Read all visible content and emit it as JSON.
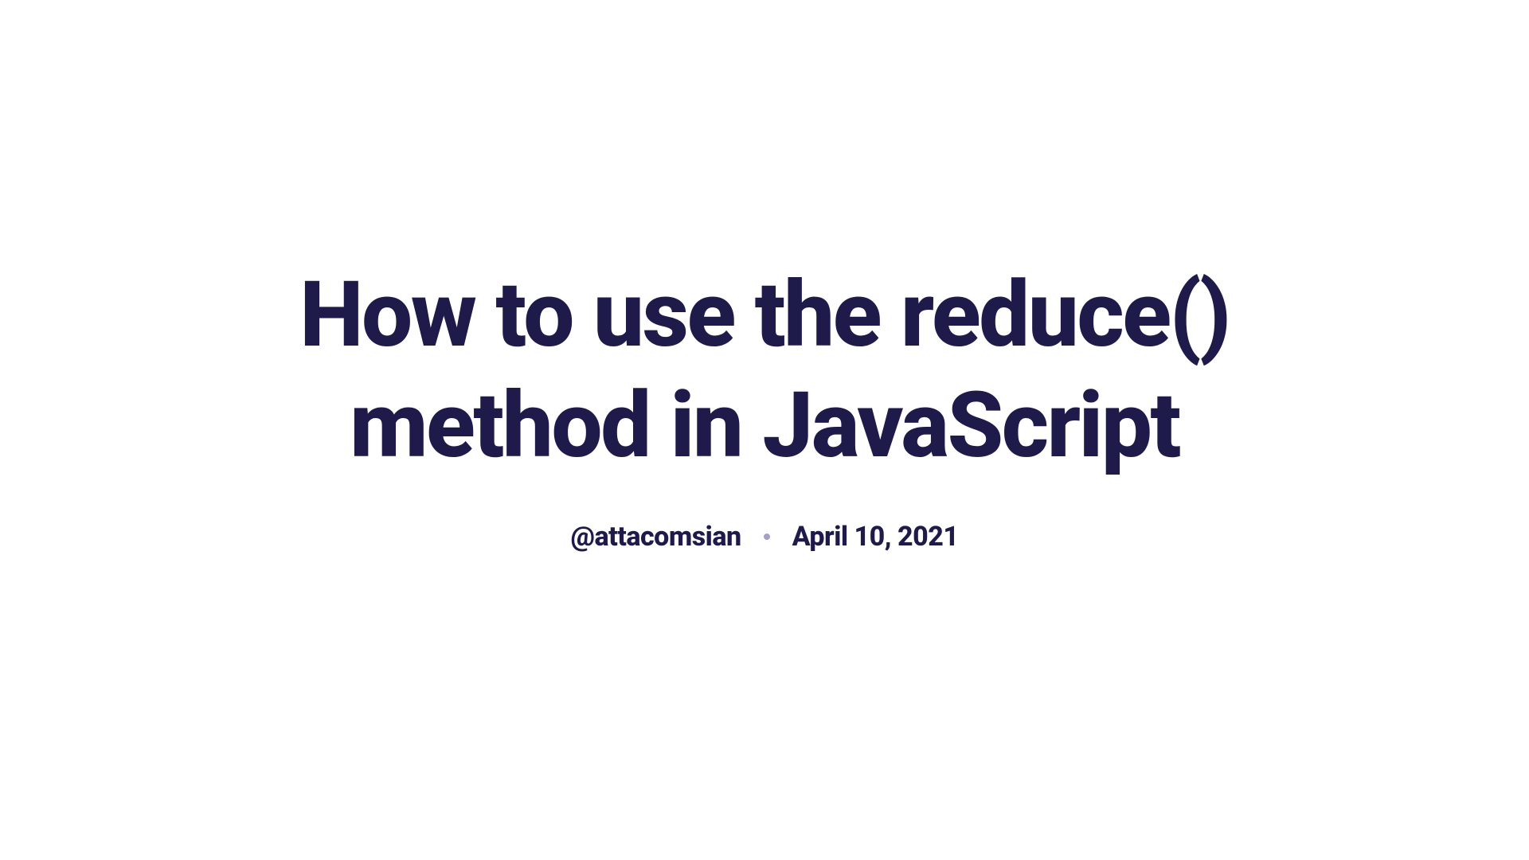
{
  "article": {
    "title": "How to use the reduce() method in JavaScript",
    "author": "@attacomsian",
    "date": "April 10, 2021"
  }
}
